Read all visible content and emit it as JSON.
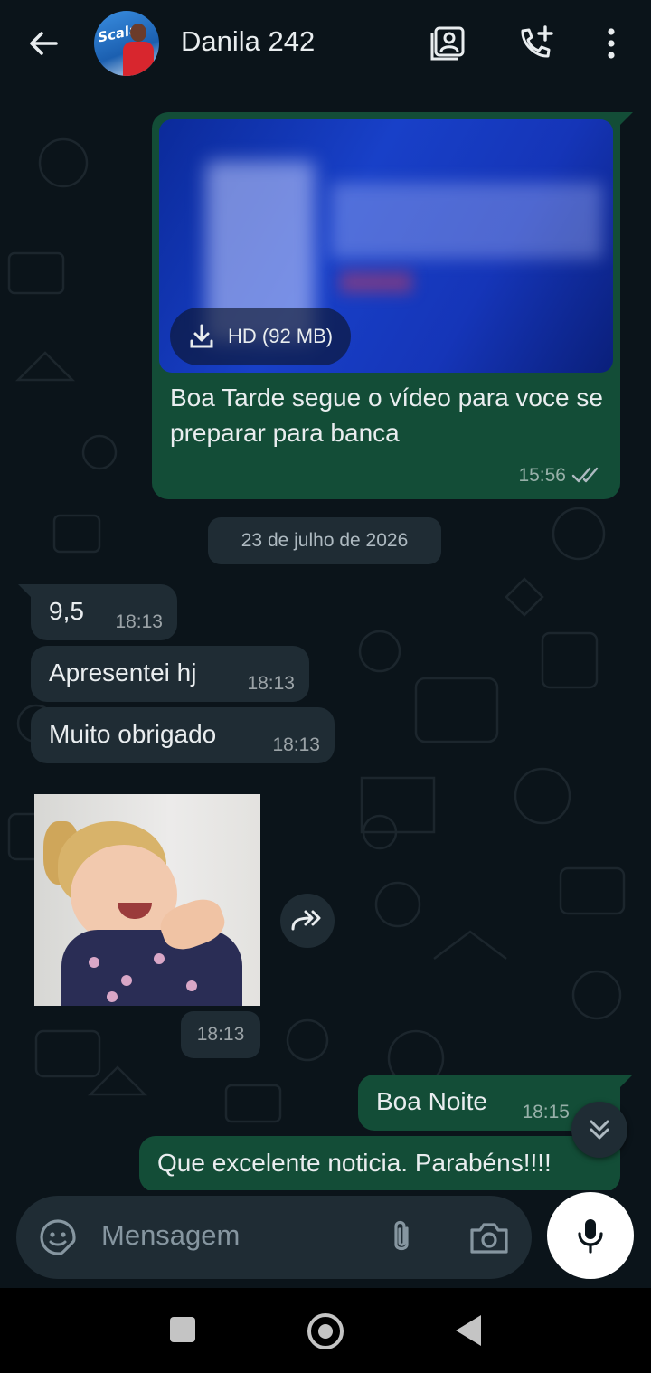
{
  "header": {
    "back_icon": "arrow-left-icon",
    "avatar_brand": "Scala",
    "contact_name": "Danila 242",
    "icons": [
      "contact-card-icon",
      "add-call-icon",
      "more-vert-icon"
    ]
  },
  "messages": {
    "video": {
      "download_label": "HD (92 MB)",
      "caption": "Boa Tarde segue o vídeo para voce se preparar para banca",
      "time": "15:56"
    },
    "date_separator": "23 de julho de 2026",
    "incoming": [
      {
        "text": "9,5",
        "time": "18:13"
      },
      {
        "text": "Apresentei hj",
        "time": "18:13"
      },
      {
        "text": "Muito obrigado",
        "time": "18:13"
      }
    ],
    "sticker_time": "18:13",
    "outgoing": [
      {
        "text": "Boa Noite",
        "time": "18:15"
      },
      {
        "text": "Que excelente noticia. Parabéns!!!!",
        "time": ""
      }
    ]
  },
  "composer": {
    "placeholder": "Mensagem",
    "icons": [
      "sticker-icon",
      "paperclip-icon",
      "camera-icon",
      "mic-icon"
    ]
  },
  "colors": {
    "background": "#0b141a",
    "outgoing_bubble": "#134d37",
    "incoming_bubble": "#1f2c34",
    "read_ticks": "#aebac1"
  }
}
